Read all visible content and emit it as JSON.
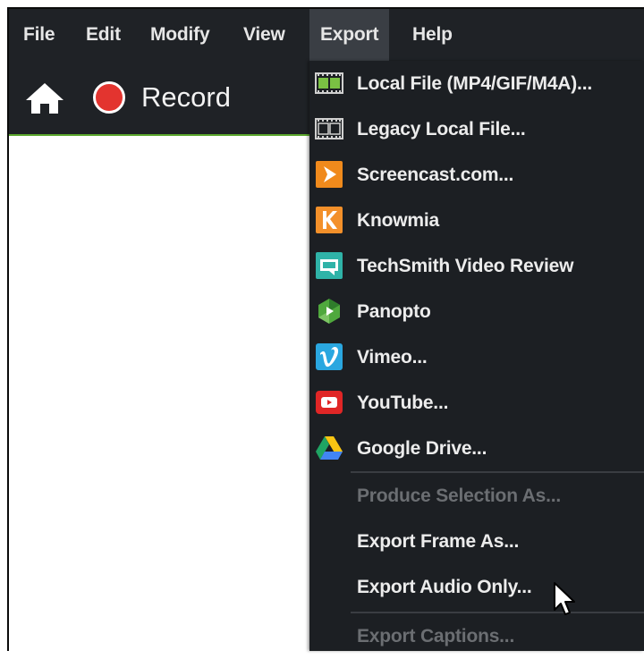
{
  "menubar": {
    "items": [
      {
        "label": "File"
      },
      {
        "label": "Edit"
      },
      {
        "label": "Modify"
      },
      {
        "label": "View"
      },
      {
        "label": "Export",
        "active": true
      },
      {
        "label": "Help"
      }
    ]
  },
  "toolbar": {
    "home_icon": "home-icon",
    "record_label": "Record",
    "record_color": "#e3342f",
    "accent_color": "#5aa62c"
  },
  "export_menu": {
    "items": [
      {
        "label": "Local File (MP4/GIF/M4A)...",
        "icon": "film-strip-green-icon",
        "enabled": true
      },
      {
        "label": "Legacy Local File...",
        "icon": "film-strip-icon",
        "enabled": true
      },
      {
        "label": "Screencast.com...",
        "icon": "screencast-icon",
        "enabled": true
      },
      {
        "label": "Knowmia",
        "icon": "knowmia-icon",
        "enabled": true
      },
      {
        "label": "TechSmith Video Review",
        "icon": "video-review-icon",
        "enabled": true
      },
      {
        "label": "Panopto",
        "icon": "panopto-icon",
        "enabled": true
      },
      {
        "label": "Vimeo...",
        "icon": "vimeo-icon",
        "enabled": true
      },
      {
        "label": "YouTube...",
        "icon": "youtube-icon",
        "enabled": true
      },
      {
        "label": "Google Drive...",
        "icon": "google-drive-icon",
        "enabled": true
      },
      {
        "label": "Produce Selection As...",
        "icon": "",
        "enabled": false
      },
      {
        "label": "Export Frame As...",
        "icon": "",
        "enabled": true
      },
      {
        "label": "Export Audio Only...",
        "icon": "",
        "enabled": true
      },
      {
        "label": "Export Captions...",
        "icon": "",
        "enabled": false
      }
    ]
  },
  "cursor_icon": "mouse-pointer-icon"
}
